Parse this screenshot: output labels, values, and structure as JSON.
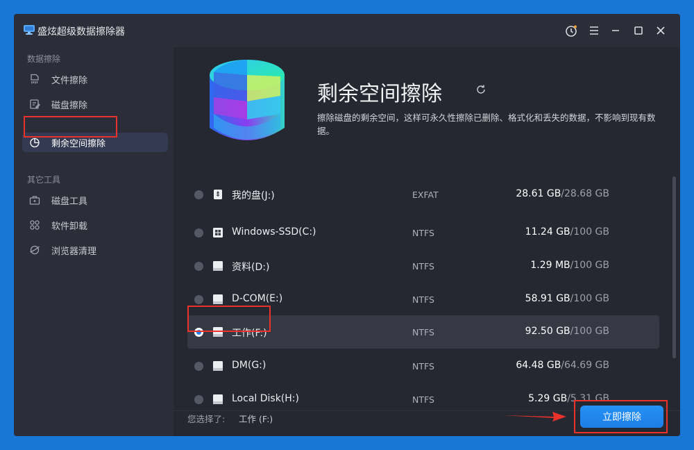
{
  "app": {
    "title": "盛炫超级数据擦除器"
  },
  "titlebar_buttons": [
    "timer-icon",
    "menu-icon",
    "minimize-icon",
    "maximize-icon",
    "close-icon"
  ],
  "sidebar": {
    "group1": "数据擦除",
    "items1": [
      {
        "label": "文件擦除",
        "icon": "file-shred-icon"
      },
      {
        "label": "磁盘擦除",
        "icon": "disk-erase-icon"
      },
      {
        "label": "剩余空间擦除",
        "icon": "pie-chart-icon"
      }
    ],
    "group2": "其它工具",
    "items2": [
      {
        "label": "磁盘工具",
        "icon": "toolbox-icon"
      },
      {
        "label": "软件卸载",
        "icon": "apps-grid-icon"
      },
      {
        "label": "浏览器清理",
        "icon": "browser-icon"
      }
    ]
  },
  "main": {
    "title": "剩余空间擦除",
    "description": "擦除磁盘的剩余空间，这样可永久性擦除已删除、格式化和丢失的数据，不影响到现有数据。",
    "drives": [
      {
        "name": "我的盘(J:)",
        "icon": "usb-drive-icon",
        "fs": "EXFAT",
        "used": "28.61 GB",
        "sep": "/",
        "total": "28.68 GB",
        "selected": false
      },
      {
        "name": "Windows-SSD(C:)",
        "icon": "windows-drive-icon",
        "fs": "NTFS",
        "used": "11.24 GB",
        "sep": "/",
        "total": "100 GB",
        "selected": false
      },
      {
        "name": "资料(D:)",
        "icon": "hard-drive-icon",
        "fs": "NTFS",
        "used": "1.29 MB",
        "sep": "/",
        "total": "100 GB",
        "selected": false
      },
      {
        "name": "D-COM(E:)",
        "icon": "hard-drive-icon",
        "fs": "NTFS",
        "used": "58.91 GB",
        "sep": "/",
        "total": "100 GB",
        "selected": false
      },
      {
        "name": "工作(F:)",
        "icon": "hard-drive-icon",
        "fs": "NTFS",
        "used": "92.50 GB",
        "sep": "/",
        "total": "100 GB",
        "selected": true
      },
      {
        "name": "DM(G:)",
        "icon": "hard-drive-icon",
        "fs": "NTFS",
        "used": "64.48 GB",
        "sep": "/",
        "total": "64.69 GB",
        "selected": false
      },
      {
        "name": "Local Disk(H:)",
        "icon": "hard-drive-icon",
        "fs": "NTFS",
        "used": "5.29 GB",
        "sep": "/",
        "total": "5.31 GB",
        "selected": false
      }
    ],
    "footer": {
      "selected_label": "您选择了:",
      "selected_value": "工作 (F:)",
      "wipe_button": "立即擦除"
    }
  },
  "colors": {
    "accent": "#1e7ff0",
    "annotation": "#e8322a",
    "background": "#1877d6"
  }
}
